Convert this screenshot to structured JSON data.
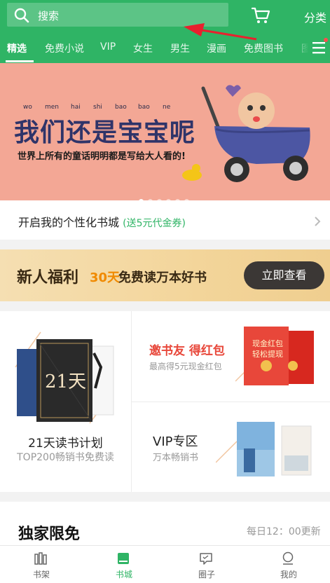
{
  "colors": {
    "brand": "#2fb465",
    "banner_bg": "#f3a795",
    "invite_red": "#e8473a",
    "welfare_orange": "#f08a00"
  },
  "search": {
    "placeholder": "搜索",
    "icon": "search-icon"
  },
  "header": {
    "cart_icon": "cart-icon",
    "category_label": "分类"
  },
  "tabs": [
    {
      "label": "精选",
      "active": true
    },
    {
      "label": "免费小说"
    },
    {
      "label": "VIP"
    },
    {
      "label": "女生"
    },
    {
      "label": "男生"
    },
    {
      "label": "漫画"
    },
    {
      "label": "免费图书"
    },
    {
      "label": "图"
    }
  ],
  "banner": {
    "pinyin": [
      "wo",
      "men",
      "hai",
      "shi",
      "bao",
      "bao",
      "ne"
    ],
    "title": "我们还是宝宝呢",
    "subtitle": "世界上所有的童话明明都是写给大人看的!",
    "slide_count": 6,
    "active_slide": 1
  },
  "promo": {
    "text": "开启我的个性化书城",
    "highlight": "(送5元代金券)"
  },
  "welfare": {
    "label": "新人福利",
    "days": "30天",
    "desc": "免费读万本好书",
    "button": "立即查看"
  },
  "reading_plan": {
    "badge": "21天",
    "title": "21天读书计划",
    "subtitle": "TOP200畅销书免费读"
  },
  "invite": {
    "title": "邀书友 得红包",
    "subtitle": "最高得5元现金红包",
    "envelope_text_1": "现金红包",
    "envelope_text_2": "轻松提现"
  },
  "vip_zone": {
    "title": "VIP专区",
    "subtitle": "万本畅销书"
  },
  "exclusive": {
    "title": "独家限免",
    "update": "每日12：00更新"
  },
  "bottom_nav": [
    {
      "label": "书架",
      "icon": "bookshelf-icon"
    },
    {
      "label": "书城",
      "icon": "bookstore-icon",
      "active": true
    },
    {
      "label": "圈子",
      "icon": "chat-icon"
    },
    {
      "label": "我的",
      "icon": "profile-icon"
    }
  ]
}
